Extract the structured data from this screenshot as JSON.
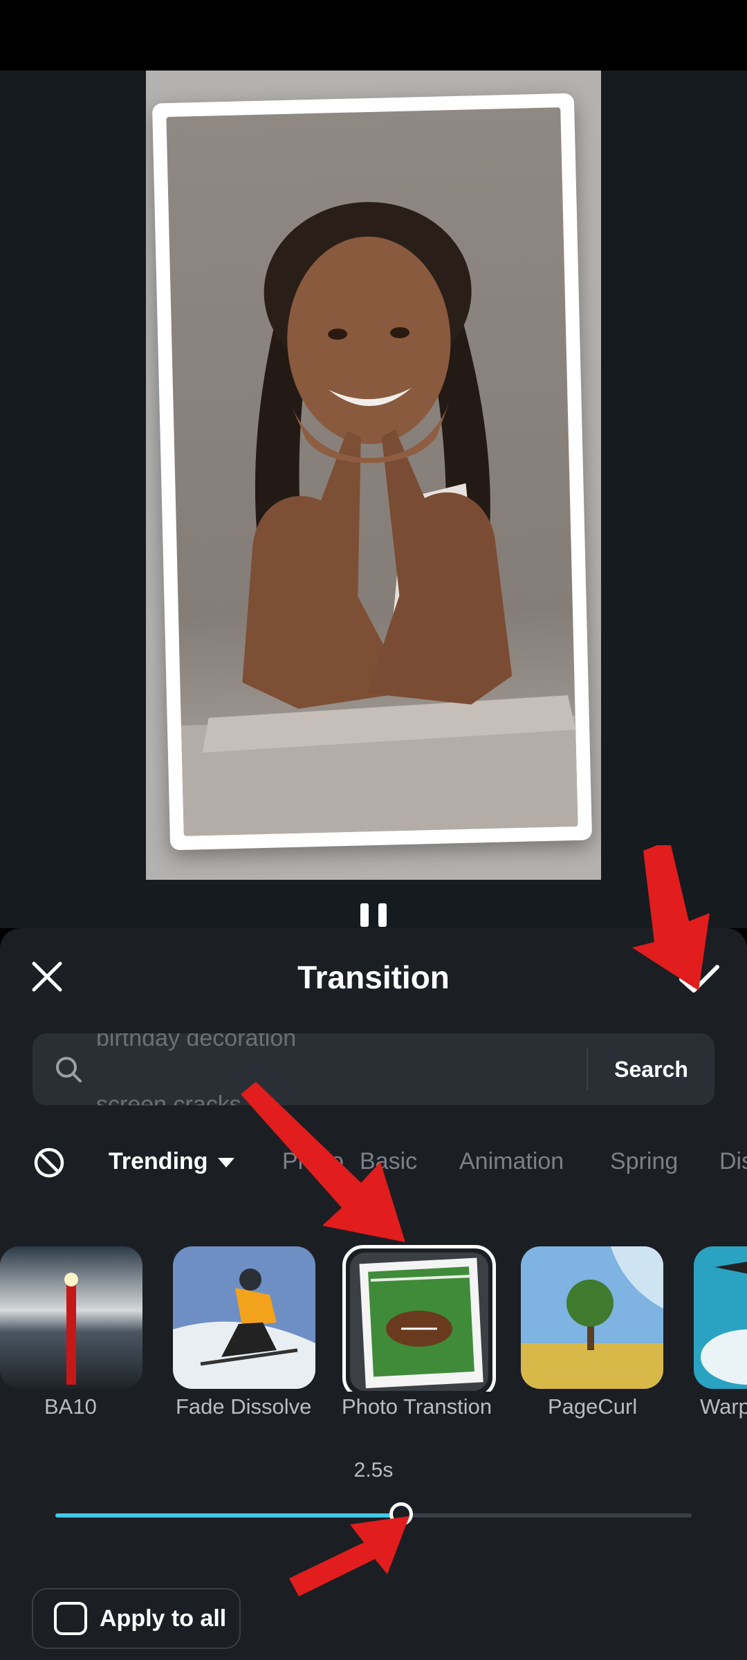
{
  "colors": {
    "accent": "#43c8e6",
    "sheet_background": "#1b1f24",
    "preview_background": "#161b20",
    "annotation_arrow": "#e11d1d"
  },
  "preview": {
    "media": "portrait photo of smiling woman with braided hair resting chin on hands, inside a tilted white photo frame",
    "playback_state": "playing",
    "control_icon": "pause-icon"
  },
  "sheet": {
    "title": "Transition",
    "close_icon": "close-icon",
    "confirm_icon": "checkmark-icon"
  },
  "search": {
    "scrolling_hints": [
      "birthday decoration",
      "screen cracks"
    ],
    "button_label": "Search"
  },
  "categories": {
    "none_icon": "none-circle-slash-icon",
    "items": [
      {
        "label": "Trending",
        "active": true
      },
      {
        "label": "Photo",
        "active": false
      },
      {
        "label": "Basic",
        "active": false
      },
      {
        "label": "Animation",
        "active": false
      },
      {
        "label": "Spring",
        "active": false
      },
      {
        "label": "Dissolve",
        "active": false
      }
    ]
  },
  "effects": {
    "items": [
      {
        "label": "BA10",
        "selected": false
      },
      {
        "label": "Fade Dissolve",
        "selected": false
      },
      {
        "label": "Photo Transtion",
        "selected": true
      },
      {
        "label": "PageCurl",
        "selected": false
      },
      {
        "label": "Warp",
        "selected": false
      }
    ]
  },
  "duration": {
    "label": "2.5s",
    "fraction": 0.543
  },
  "apply_all": {
    "label": "Apply to all",
    "checked": false
  }
}
